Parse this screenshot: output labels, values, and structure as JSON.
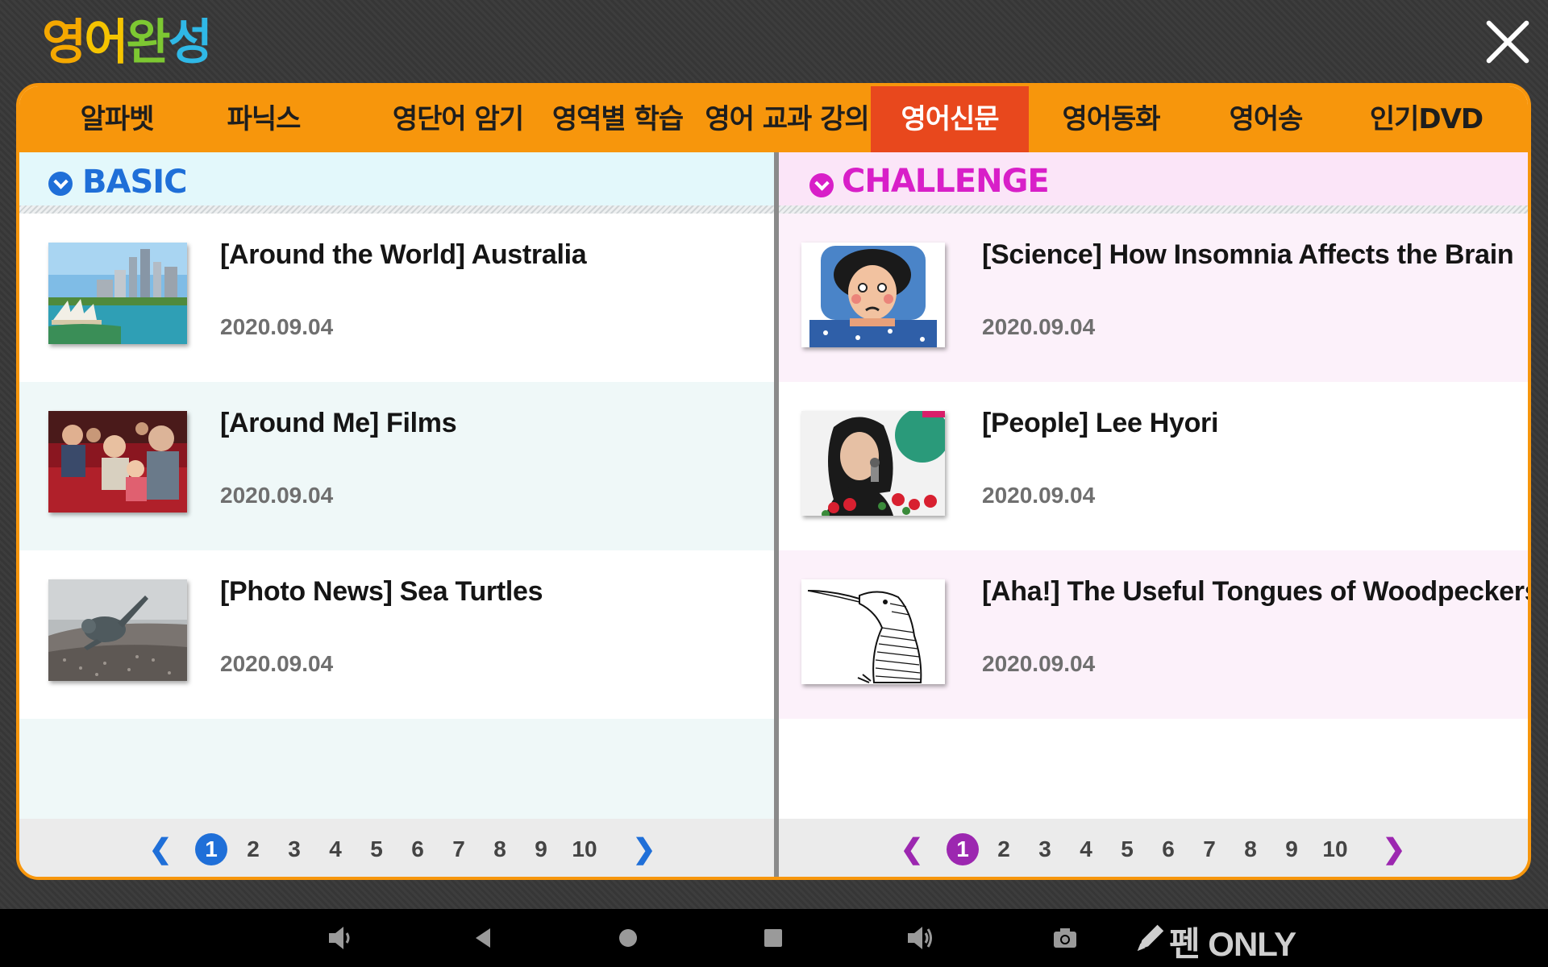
{
  "app": {
    "logo_chars": [
      "영",
      "어",
      "완",
      "성"
    ],
    "logo_colors": [
      "#f5a800",
      "#f5c400",
      "#7dc832",
      "#2fb8e6"
    ],
    "close_icon": "close-icon"
  },
  "tabs": [
    {
      "label": "알파벳",
      "active": false
    },
    {
      "label": "파닉스",
      "active": false
    },
    {
      "label": "영단어 암기",
      "active": false
    },
    {
      "label": "영역별 학습",
      "active": false
    },
    {
      "label": "영어 교과 강의",
      "active": false
    },
    {
      "label": "영어신문",
      "active": true
    },
    {
      "label": "영어동화",
      "active": false
    },
    {
      "label": "영어송",
      "active": false
    },
    {
      "label": "인기DVD",
      "active": false
    }
  ],
  "basic": {
    "heading": "BASIC",
    "accent": "#1f6fd8",
    "items": [
      {
        "title": "[Around the World] Australia",
        "date": "2020.09.04",
        "thumb": "sydney-opera-house-photo"
      },
      {
        "title": "[Around Me] Films",
        "date": "2020.09.04",
        "thumb": "cinema-audience-photo"
      },
      {
        "title": "[Photo News] Sea Turtles",
        "date": "2020.09.04",
        "thumb": "sea-turtle-photo"
      }
    ],
    "pager": {
      "prev": "❮",
      "next": "❯",
      "pages": [
        "1",
        "2",
        "3",
        "4",
        "5",
        "6",
        "7",
        "8",
        "9",
        "10"
      ],
      "current": "1"
    }
  },
  "challenge": {
    "heading": "CHALLENGE",
    "accent": "#d81fc8",
    "items": [
      {
        "title": "[Science] How Insomnia Affects the Brain",
        "date": "2020.09.04",
        "thumb": "insomnia-illustration"
      },
      {
        "title": "[People] Lee Hyori",
        "date": "2020.09.04",
        "thumb": "singer-photo"
      },
      {
        "title": "[Aha!] The Useful Tongues of Woodpeckers",
        "date": "2020.09.04",
        "thumb": "woodpecker-sketch"
      }
    ],
    "pager": {
      "prev": "❮",
      "next": "❯",
      "pages": [
        "1",
        "2",
        "3",
        "4",
        "5",
        "6",
        "7",
        "8",
        "9",
        "10"
      ],
      "current": "1"
    }
  },
  "navbar": {
    "icons": [
      "volume-down-icon",
      "back-icon",
      "home-icon",
      "recents-icon",
      "volume-up-icon",
      "camera-icon",
      "pen-icon"
    ],
    "pen_label": "펜 ONLY"
  }
}
